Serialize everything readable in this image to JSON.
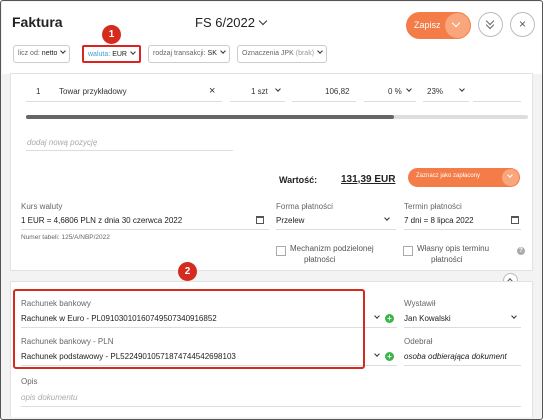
{
  "header": {
    "title": "Faktura",
    "doc_number": "FS 6/2022",
    "save_label": "Zapisz",
    "close_glyph": "×"
  },
  "filters": {
    "calc_label": "licz od:",
    "calc_value": "netto",
    "currency_label": "waluta:",
    "currency_value": "EUR",
    "transaction_label": "rodzaj transakcji:",
    "transaction_value": "SK",
    "jpk_label": "Oznaczenia JPK",
    "jpk_value": "(brak)"
  },
  "annotations": {
    "badge1": "1",
    "badge2": "2"
  },
  "line_item": {
    "index": "1",
    "name": "Towar przykładowy",
    "remove_glyph": "×",
    "quantity": "1 szt",
    "price": "106,82",
    "discount": "0 %",
    "vat": "23%"
  },
  "add_item_placeholder": "dodaj nową pozycję",
  "totals": {
    "label": "Wartość:",
    "value": "131,39 EUR",
    "mark_paid_label": "Zaznacz jako zapłacony"
  },
  "exchange": {
    "label": "Kurs waluty",
    "value": "1  EUR = 4,6806  PLN z dnia 30 czerwca 2022",
    "table_number": "Numer tabeli: 125/A/NBP/2022"
  },
  "payment": {
    "label": "Forma płatności",
    "value": "Przelew",
    "split_label_1": "Mechanizm podzielonej",
    "split_label_2": "płatności"
  },
  "due": {
    "label": "Termin płatności",
    "value": "7 dni = 8 lipca 2022",
    "own_label_1": "Własny opis terminu",
    "own_label_2": "płatności",
    "help_glyph": "?"
  },
  "bank": {
    "label1": "Rachunek bankowy",
    "value1": "Rachunek w Euro - PL09103010160749507340916852",
    "label2": "Rachunek bankowy - PLN",
    "value2": "Rachunek podstawowy - PL52249010571874744542698103",
    "plus_glyph": "+"
  },
  "issuer": {
    "label": "Wystawił",
    "value": "Jan Kowalski"
  },
  "receiver": {
    "label": "Odebrał",
    "placeholder": "osoba odbierająca dokument"
  },
  "notes": {
    "label": "Opis",
    "placeholder": "opis dokumentu"
  },
  "colors": {
    "accent": "#f47c48",
    "highlight": "#d52b1e",
    "add": "#3bb54a",
    "link": "#3b9ee0"
  }
}
